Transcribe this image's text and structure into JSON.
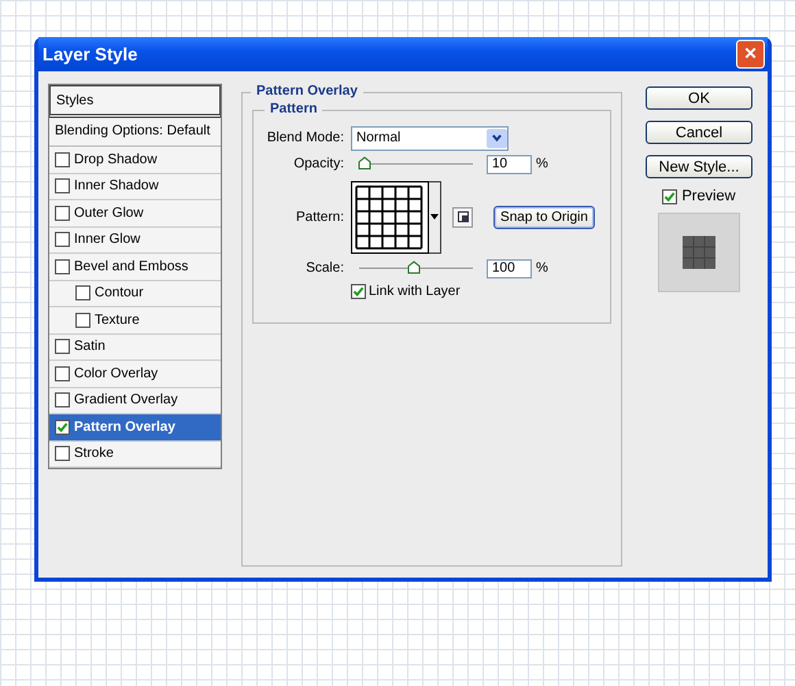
{
  "window": {
    "title": "Layer Style",
    "close": "✕"
  },
  "styles_list": {
    "header": "Styles",
    "blending": "Blending Options: Default",
    "items": [
      {
        "label": "Drop Shadow",
        "checked": false,
        "selected": false
      },
      {
        "label": "Inner Shadow",
        "checked": false,
        "selected": false
      },
      {
        "label": "Outer Glow",
        "checked": false,
        "selected": false
      },
      {
        "label": "Inner Glow",
        "checked": false,
        "selected": false
      },
      {
        "label": "Bevel and Emboss",
        "checked": false,
        "selected": false,
        "children": [
          {
            "label": "Contour",
            "checked": false,
            "selected": false
          },
          {
            "label": "Texture",
            "checked": false,
            "selected": false
          }
        ]
      },
      {
        "label": "Satin",
        "checked": false,
        "selected": false
      },
      {
        "label": "Color Overlay",
        "checked": false,
        "selected": false
      },
      {
        "label": "Gradient Overlay",
        "checked": false,
        "selected": false
      },
      {
        "label": "Pattern Overlay",
        "checked": true,
        "selected": true
      },
      {
        "label": "Stroke",
        "checked": false,
        "selected": false
      }
    ]
  },
  "panel": {
    "title": "Pattern Overlay",
    "group": "Pattern",
    "blend_mode": {
      "label": "Blend Mode:",
      "value": "Normal"
    },
    "opacity": {
      "label": "Opacity:",
      "level": 0.05,
      "value": "10",
      "unit": "%"
    },
    "pattern": {
      "label": "Pattern:",
      "snap_button": "Snap to Origin"
    },
    "scale": {
      "label": "Scale:",
      "level": 0.48,
      "value": "100",
      "unit": "%"
    },
    "link": {
      "label": "Link with Layer",
      "checked": true
    }
  },
  "buttons": [
    "OK",
    "Cancel",
    "New Style..."
  ],
  "preview": {
    "label": "Preview",
    "checked": true
  }
}
